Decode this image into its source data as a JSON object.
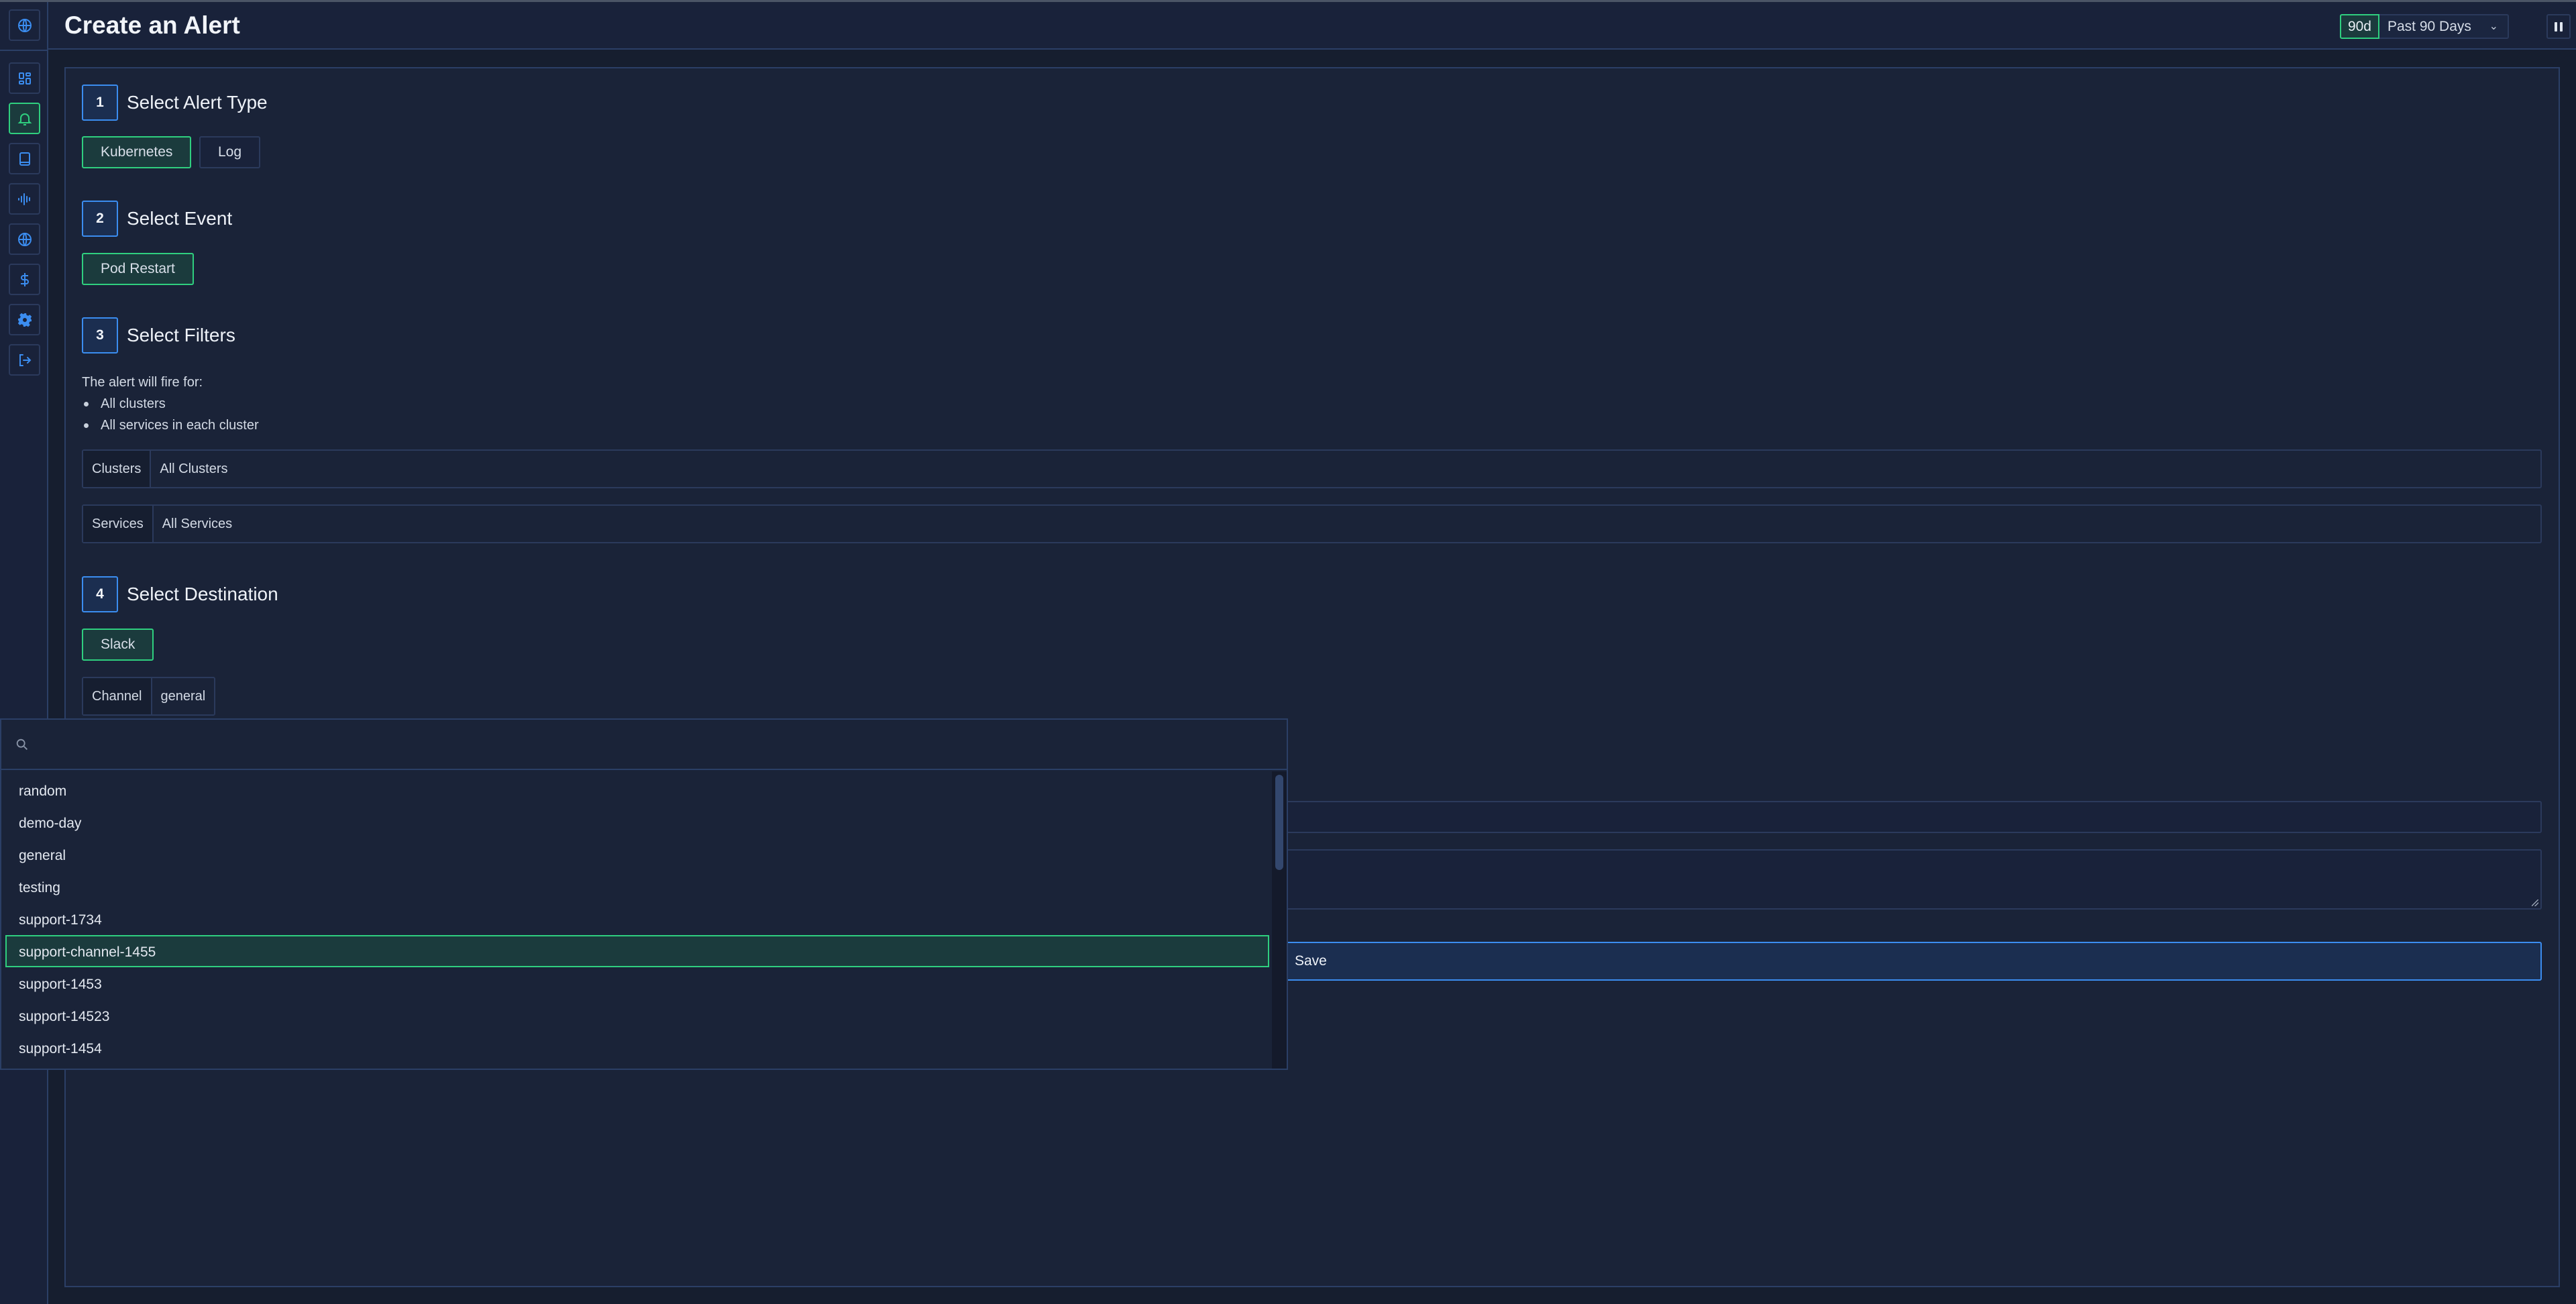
{
  "header": {
    "title": "Create an Alert",
    "time_range_badge": "90d",
    "time_range_label": "Past 90 Days"
  },
  "sidebar": {
    "items": [
      {
        "icon": "globe-icon",
        "label": "Home"
      },
      {
        "icon": "dashboard-icon",
        "label": "Dashboard"
      },
      {
        "icon": "bell-icon",
        "label": "Alerts",
        "active": true
      },
      {
        "icon": "book-icon",
        "label": "Docs"
      },
      {
        "icon": "waveform-icon",
        "label": "Signals"
      },
      {
        "icon": "globe-icon",
        "label": "Network"
      },
      {
        "icon": "dollar-icon",
        "label": "Cost"
      },
      {
        "icon": "gear-icon",
        "label": "Settings"
      },
      {
        "icon": "logout-icon",
        "label": "Log out"
      }
    ]
  },
  "steps": [
    {
      "number": "1",
      "title": "Select Alert Type",
      "options": [
        {
          "label": "Kubernetes",
          "selected": true
        },
        {
          "label": "Log",
          "selected": false
        }
      ]
    },
    {
      "number": "2",
      "title": "Select Event",
      "options": [
        {
          "label": "Pod Restart",
          "selected": true
        }
      ]
    },
    {
      "number": "3",
      "title": "Select Filters"
    },
    {
      "number": "4",
      "title": "Select Destination",
      "options": [
        {
          "label": "Slack",
          "selected": true
        }
      ]
    }
  ],
  "filters": {
    "intro": "The alert will fire for:",
    "bullets": [
      "All clusters",
      "All services in each cluster"
    ],
    "clusters_label": "Clusters",
    "clusters_value": "All Clusters",
    "services_label": "Services",
    "services_value": "All Services"
  },
  "destination": {
    "channel_label": "Channel",
    "channel_value": "general"
  },
  "form": {
    "name_value": "",
    "description_value": "",
    "save_label": "Save"
  },
  "channel_dropdown": {
    "search_value": "",
    "selected": "support-channel-1455",
    "options": [
      "random",
      "demo-day",
      "general",
      "testing",
      "support-1734",
      "support-channel-1455",
      "support-1453",
      "support-14523",
      "support-1454"
    ]
  },
  "colors": {
    "accent_green": "#2fcf7f",
    "accent_blue": "#3b8df0",
    "background": "#1a2338"
  }
}
